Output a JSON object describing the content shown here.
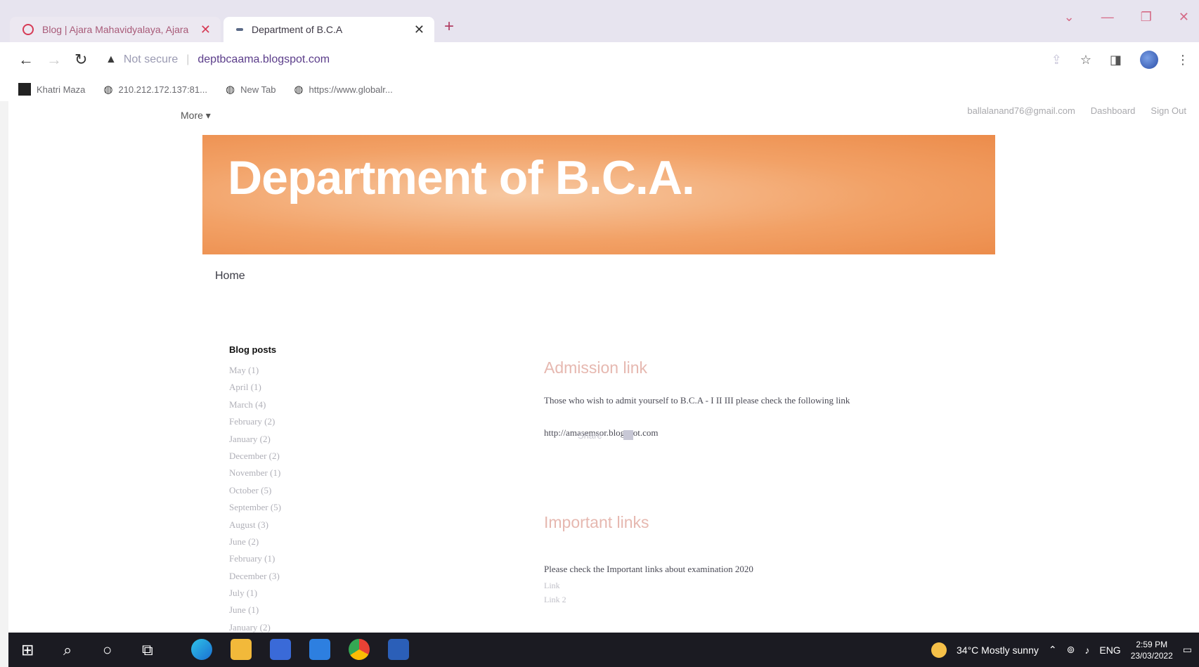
{
  "browser": {
    "tabs": [
      {
        "title": "Blog | Ajara Mahavidyalaya, Ajara",
        "close": "✕"
      },
      {
        "title": "Department of B.C.A",
        "close": "✕"
      }
    ],
    "new_tab": "+",
    "window_controls": [
      "⌄",
      "—",
      "❐",
      "✕"
    ],
    "security_label": "Not secure",
    "url": "deptbcaama.blogspot.com",
    "bookmarks": [
      "Khatri Maza",
      "210.212.172.137:81...",
      "New Tab",
      "https://www.globalr..."
    ]
  },
  "page": {
    "more_label": "More ▾",
    "account_email": "ballalanand76@gmail.com",
    "dashboard_label": "Dashboard",
    "signout_label": "Sign Out",
    "blog_title": "Department of B.C.A.",
    "home_label": "Home",
    "sidebar": {
      "title": "Blog posts",
      "archive": [
        "May (1)",
        "April (1)",
        "March (4)",
        "February (2)",
        "January (2)",
        "December (2)",
        "November (1)",
        "October (5)",
        "September (5)",
        "August (3)",
        "June (2)",
        "February (1)",
        "December (3)",
        "July (1)",
        "June (1)",
        "January (2)"
      ]
    },
    "posts": [
      {
        "title": "Admission link",
        "text": "Those who wish to admit yourself to B.C.A - I II III please check the following link",
        "link": "http://amasemsor.blogspot.com"
      },
      {
        "title": "Important links",
        "text": "Please check the Important links about examination 2020",
        "items": [
          "Link",
          "Link 2"
        ]
      }
    ],
    "share_label": "Share"
  },
  "taskbar": {
    "weather": "34°C  Mostly sunny",
    "lang": "ENG",
    "time": "2:59 PM",
    "date": "23/03/2022"
  }
}
